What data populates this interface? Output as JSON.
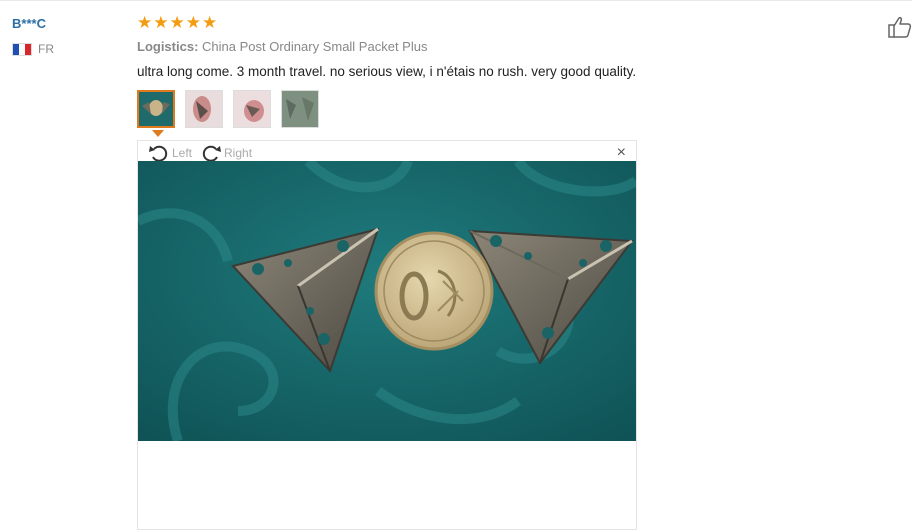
{
  "reviewer": {
    "name": "B***C",
    "country": "FR"
  },
  "rating": {
    "stars": 5,
    "max": 5
  },
  "logistics": {
    "label": "Logistics:",
    "value": "China Post Ordinary Small Packet Plus"
  },
  "review": {
    "text": "ultra long come. 3 month travel. no serious view, i n'étais no rush. very good quality."
  },
  "viewer": {
    "rotate_left": "Left",
    "rotate_right": "Right",
    "close": "×"
  },
  "icons": [
    "thumbs-up-icon",
    "rotate-left-icon",
    "rotate-right-icon",
    "close-icon",
    "star-icon"
  ],
  "colors": {
    "accent": "#e07a1f",
    "star": "#f39c12",
    "username": "#2b6ea6"
  }
}
